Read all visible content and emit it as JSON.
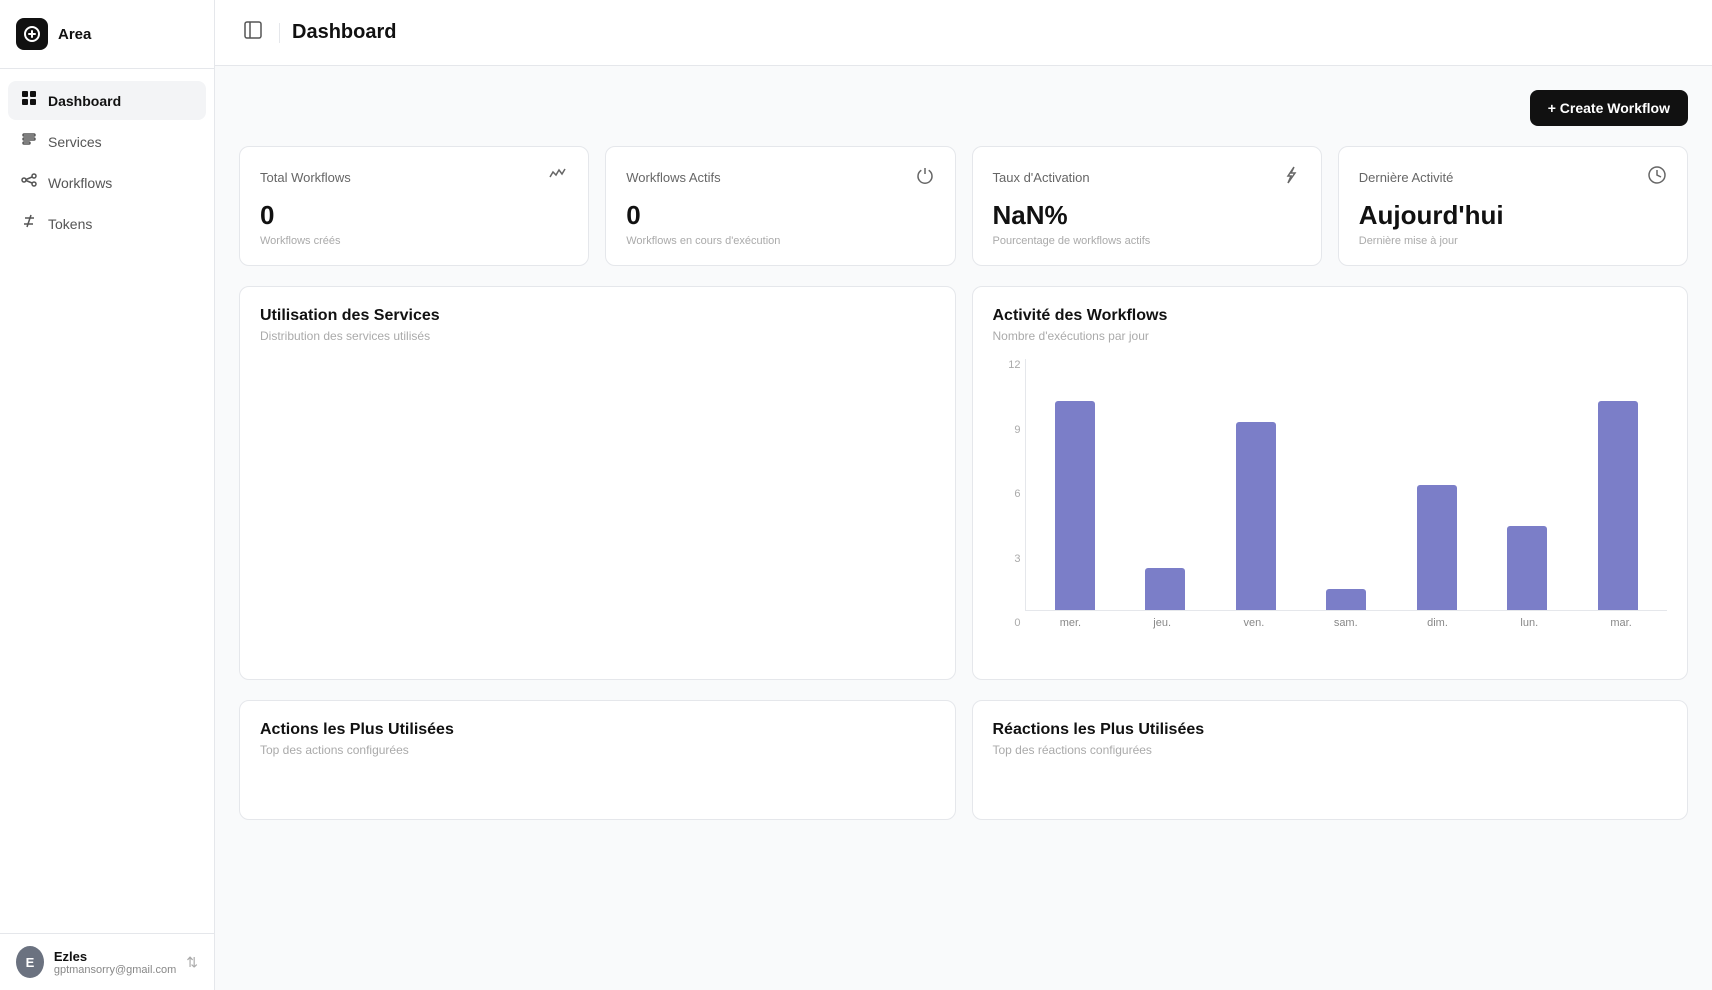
{
  "app": {
    "logo_icon": "⚙",
    "logo_text": "Area",
    "sidebar_toggle_icon": "▣"
  },
  "sidebar": {
    "items": [
      {
        "id": "dashboard",
        "label": "Dashboard",
        "icon": "⊞",
        "active": true
      },
      {
        "id": "services",
        "label": "Services",
        "icon": "📖",
        "active": false
      },
      {
        "id": "workflows",
        "label": "Workflows",
        "icon": "◈",
        "active": false
      },
      {
        "id": "tokens",
        "label": "Tokens",
        "icon": "🔑",
        "active": false
      }
    ]
  },
  "user": {
    "name": "Ezles",
    "email": "gptmansorry@gmail.com",
    "initials": "E"
  },
  "header": {
    "title": "Dashboard"
  },
  "toolbar": {
    "create_label": "+ Create Workflow"
  },
  "stats": [
    {
      "id": "total-workflows",
      "label": "Total Workflows",
      "value": "0",
      "sub": "Workflows créés",
      "icon": "〜"
    },
    {
      "id": "active-workflows",
      "label": "Workflows Actifs",
      "value": "0",
      "sub": "Workflows en cours d'exécution",
      "icon": "⏻"
    },
    {
      "id": "activation-rate",
      "label": "Taux d'Activation",
      "value": "NaN%",
      "sub": "Pourcentage de workflows actifs",
      "icon": "⚡"
    },
    {
      "id": "last-activity",
      "label": "Dernière Activité",
      "value": "Aujourd'hui",
      "sub": "Dernière mise à jour",
      "icon": "🕐"
    }
  ],
  "charts": {
    "services": {
      "title": "Utilisation des Services",
      "subtitle": "Distribution des services utilisés"
    },
    "activity": {
      "title": "Activité des Workflows",
      "subtitle": "Nombre d'exécutions par jour",
      "y_labels": [
        "12",
        "9",
        "6",
        "3",
        "0"
      ],
      "bars": [
        {
          "label": "mer.",
          "value": 10
        },
        {
          "label": "jeu.",
          "value": 2
        },
        {
          "label": "ven.",
          "value": 9
        },
        {
          "label": "sam.",
          "value": 1
        },
        {
          "label": "dim.",
          "value": 6
        },
        {
          "label": "lun.",
          "value": 4
        },
        {
          "label": "mar.",
          "value": 10
        }
      ],
      "max_value": 12
    }
  },
  "bottom_cards": [
    {
      "title": "Actions les Plus Utilisées",
      "subtitle": "Top des actions configurées"
    },
    {
      "title": "Réactions les Plus Utilisées",
      "subtitle": "Top des réactions configurées"
    }
  ]
}
